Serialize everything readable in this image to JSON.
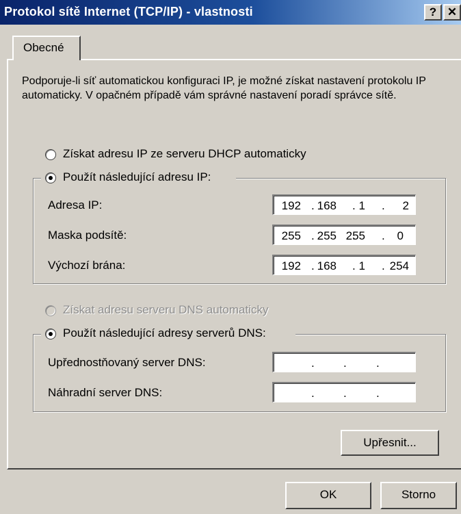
{
  "window": {
    "title": "Protokol sítě Internet (TCP/IP) - vlastnosti",
    "help_label": "?",
    "close_label": "✕"
  },
  "tabs": [
    {
      "label": "Obecné"
    }
  ],
  "description": "Podporuje-li síť automatickou konfiguraci IP, je možné získat nastavení protokolu IP automaticky. V opačném případě vám správné nastavení poradí správce sítě.",
  "ip": {
    "auto_label": "Získat adresu IP ze serveru DHCP automaticky",
    "manual_label": "Použít následující adresu IP:",
    "fields": [
      {
        "label": "Adresa IP:",
        "octets": [
          "192",
          "168",
          "1",
          "2"
        ]
      },
      {
        "label": "Maska podsítě:",
        "octets": [
          "255",
          "255",
          "255",
          "0"
        ]
      },
      {
        "label": "Výchozí brána:",
        "octets": [
          "192",
          "168",
          "1",
          "254"
        ]
      }
    ]
  },
  "dns": {
    "auto_label": "Získat adresu serveru DNS automaticky",
    "manual_label": "Použít následující adresy serverů DNS:",
    "fields": [
      {
        "label": "Upřednostňovaný server DNS:",
        "octets": [
          "",
          "",
          "",
          ""
        ]
      },
      {
        "label": "Náhradní server DNS:",
        "octets": [
          "",
          "",
          "",
          ""
        ]
      }
    ]
  },
  "buttons": {
    "advanced": "Upřesnit...",
    "ok": "OK",
    "cancel": "Storno"
  }
}
